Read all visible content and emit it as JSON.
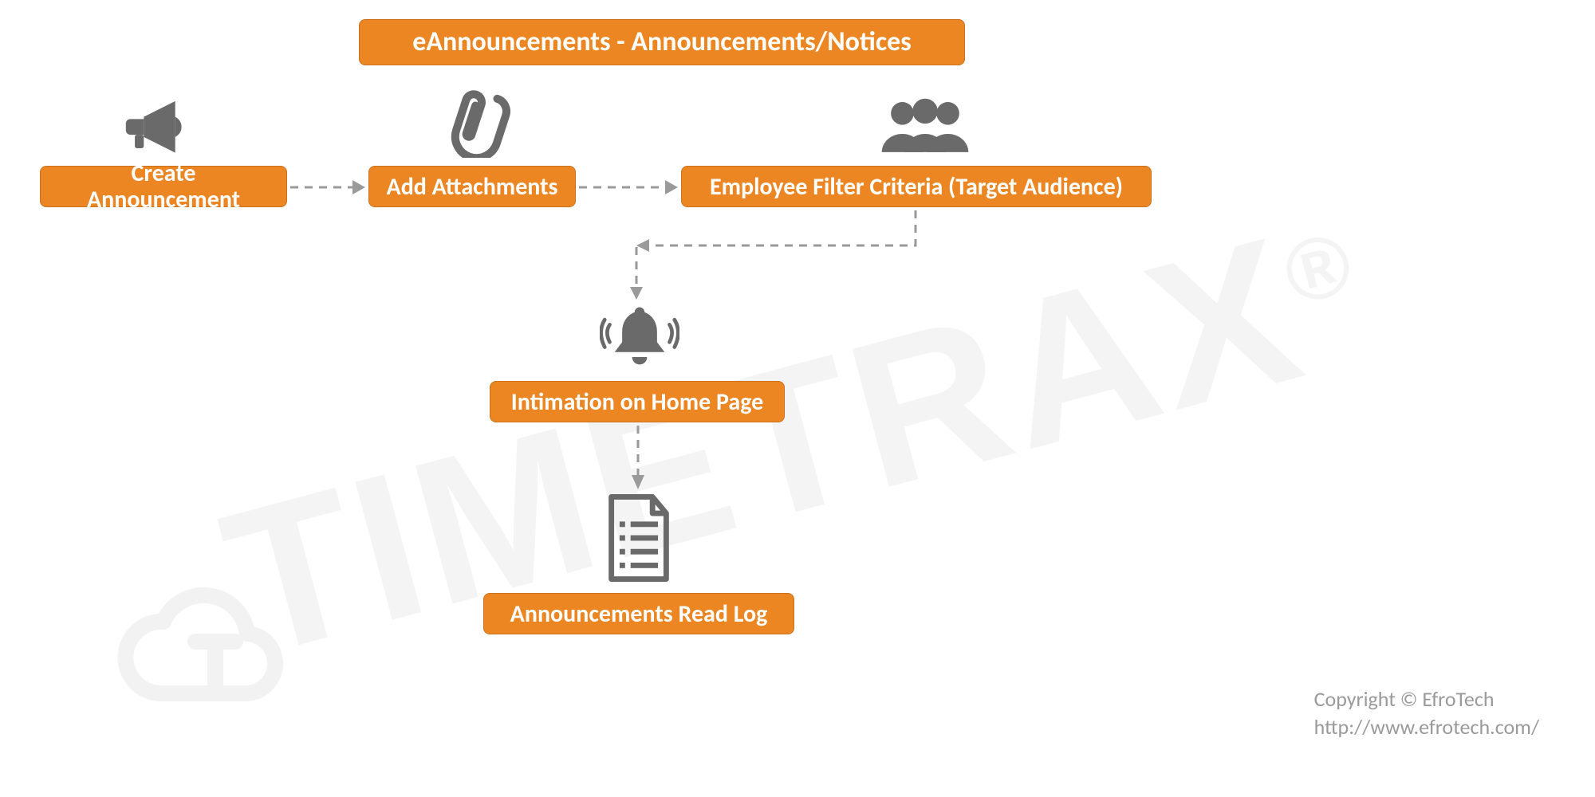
{
  "title": "eAnnouncements - Announcements/Notices",
  "nodes": {
    "create": "Create Announcement",
    "attach": "Add Attachments",
    "filter": "Employee Filter Criteria (Target Audience)",
    "intimation": "Intimation on Home Page",
    "readlog": "Announcements Read Log"
  },
  "icons": {
    "create": "megaphone-icon",
    "attach": "paperclip-icon",
    "filter": "users-icon",
    "intimation": "bell-icon",
    "readlog": "list-document-icon"
  },
  "watermark": {
    "text": "TIMETRAX",
    "registered": "®"
  },
  "footer": {
    "copyright": "Copyright © EfroTech",
    "url": "http://www.efrotech.com/"
  },
  "colors": {
    "accent": "#EC8623",
    "gray": "#6a6a6a"
  }
}
